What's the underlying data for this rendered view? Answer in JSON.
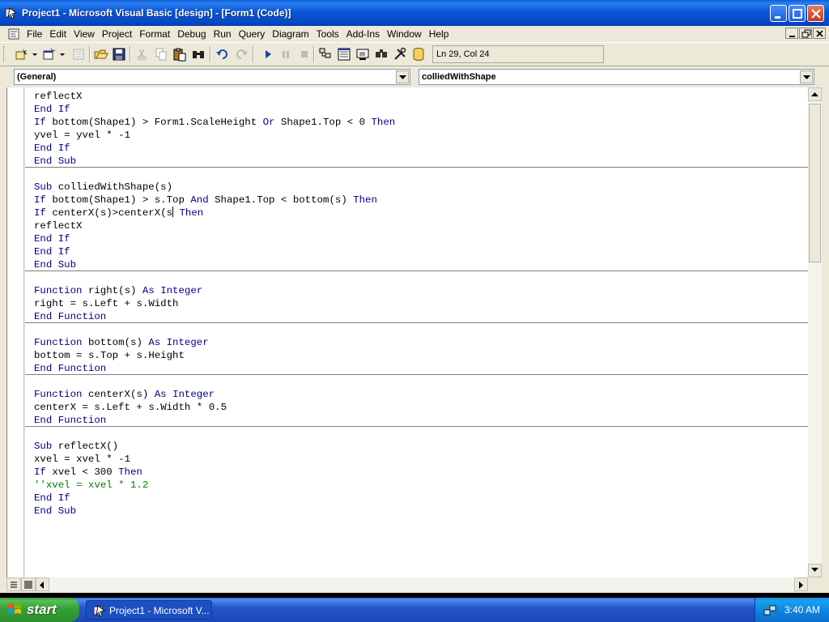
{
  "window": {
    "title": "Project1 - Microsoft Visual Basic [design] - [Form1 (Code)]"
  },
  "menu": [
    "File",
    "Edit",
    "View",
    "Project",
    "Format",
    "Debug",
    "Run",
    "Query",
    "Diagram",
    "Tools",
    "Add-Ins",
    "Window",
    "Help"
  ],
  "toolbar": {
    "position": "Ln 29, Col 24",
    "icons": [
      "add-project-icon",
      "add-form-icon",
      "menu-editor-icon",
      "open-project-icon",
      "save-project-icon",
      "cut-icon",
      "copy-icon",
      "paste-icon",
      "find-icon",
      "undo-icon",
      "redo-icon",
      "start-icon",
      "break-icon",
      "end-icon",
      "project-explorer-icon",
      "properties-window-icon",
      "form-layout-icon",
      "object-browser-icon",
      "toolbox-icon",
      "data-view-icon"
    ]
  },
  "object_combo": "(General)",
  "procedure_combo": "colliedWithShape",
  "code": {
    "lines": [
      "reflectX",
      "End If",
      "If bottom(Shape1) > Form1.ScaleHeight Or Shape1.Top < 0 Then",
      "yvel = yvel * -1",
      "End If",
      "End Sub",
      "",
      "Sub colliedWithShape(s)",
      "If bottom(Shape1) > s.Top And Shape1.Top < bottom(s) Then",
      "If centerX(s)>centerX(s",
      "reflectX",
      "End If",
      "End If",
      "End Sub",
      "",
      "Function right(s) As Integer",
      "right = s.Left + s.Width",
      "End Function",
      "",
      "Function bottom(s) As Integer",
      "bottom = s.Top + s.Height",
      "End Function",
      "",
      "Function centerX(s) As Integer",
      "centerX = s.Left + s.Width * 0.5",
      "End Function",
      "",
      "Sub reflectX()",
      "xvel = xvel * -1",
      "If xvel < 300 Then",
      "''xvel = xvel * 1.2",
      "End If",
      "End Sub"
    ],
    "caret_line_suffix": " Then"
  },
  "taskbar": {
    "start_label": "start",
    "task_label": "Project1 - Microsoft V...",
    "clock": "3:40 AM"
  }
}
